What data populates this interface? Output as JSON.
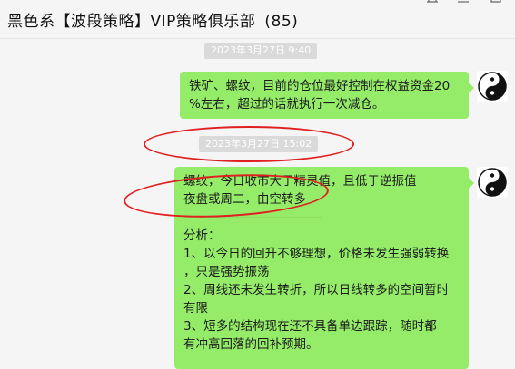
{
  "window": {
    "title": "黑色系【波段策略】VIP策略俱乐部",
    "member_count": "(85)",
    "controls": {
      "pin": "pin-icon",
      "minimize": "minimize-icon",
      "maximize": "maximize-icon"
    }
  },
  "messages": [
    {
      "timestamp": "2023年3月27日 9:40",
      "avatar_icon": "yin-yang-icon",
      "lines": [
        "铁矿、螺纹，目前的仓位最好控制在权益资金20",
        "%左右，超过的话就执行一次减仓。"
      ]
    },
    {
      "timestamp": "2023年3月27日 15:02",
      "avatar_icon": "yin-yang-icon",
      "lines": [
        "螺纹，今日收市大于精灵值，且低于逆振值",
        "夜盘或周二，由空转多",
        "-----------------------------------",
        "分析：",
        "1、以今日的回升不够理想，价格未发生强弱转换",
        "，只是强势振荡",
        "2、周线还未发生转折，所以日线转多的空间暂时",
        " 有限",
        "3、短多的结构现在还不具备单边跟踪，随时都",
        "有冲高回落的回补预期。"
      ]
    }
  ],
  "colors": {
    "bubble": "#95ec69",
    "annotation": "#e02020",
    "timestamp_bg": "#dadada",
    "background": "#f5f5f5"
  }
}
